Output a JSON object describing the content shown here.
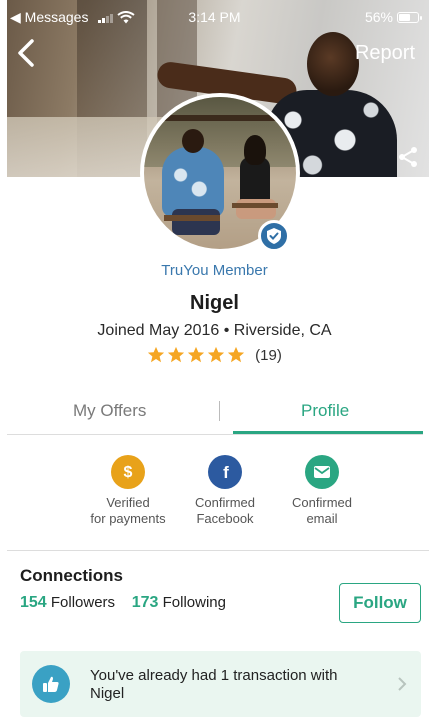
{
  "status_bar": {
    "back_app": "◀ Messages",
    "time": "3:14 PM",
    "battery": "56%"
  },
  "header": {
    "report_label": "Report"
  },
  "profile": {
    "member_label": "TruYou Member",
    "name": "Nigel",
    "joined": "Joined May 2016 • Riverside, CA",
    "rating_stars": 5,
    "rating_count": "(19)"
  },
  "tabs": [
    {
      "label": "My Offers",
      "active": false
    },
    {
      "label": "Profile",
      "active": true
    }
  ],
  "verifications": [
    {
      "icon": "dollar-icon",
      "line1": "Verified",
      "line2": "for payments",
      "color": "#e8a21a"
    },
    {
      "icon": "facebook-icon",
      "line1": "Confirmed",
      "line2": "Facebook",
      "color": "#2c5aa0"
    },
    {
      "icon": "email-icon",
      "line1": "Confirmed",
      "line2": "email",
      "color": "#2aa682"
    }
  ],
  "connections": {
    "title": "Connections",
    "followers_count": "154",
    "followers_label": "Followers",
    "following_count": "173",
    "following_label": "Following",
    "follow_button": "Follow"
  },
  "transaction": {
    "text": "You've already had 1 transaction with Nigel"
  },
  "colors": {
    "accent_green": "#2aa682",
    "link_blue": "#3a78ad",
    "star": "#f5a623"
  }
}
